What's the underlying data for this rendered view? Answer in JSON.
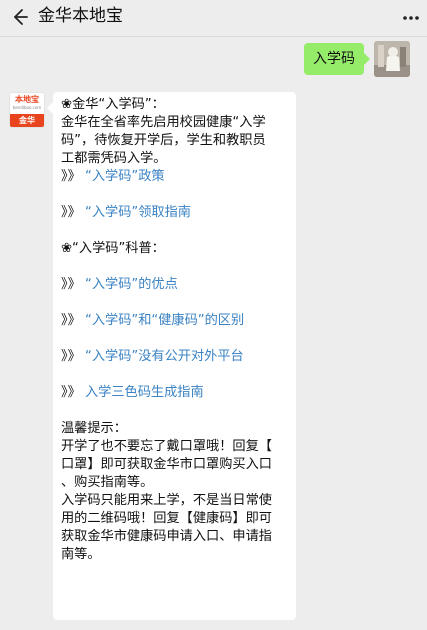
{
  "header": {
    "title": "金华本地宝",
    "back_icon": "chevron-left-icon",
    "more_icon": "more-dots-icon"
  },
  "outgoing": {
    "text": "入学码"
  },
  "bot_avatar": {
    "logo_text": "本地宝",
    "logo_sub": "bendibao.com",
    "city": "金华"
  },
  "message": {
    "line1": "❀金华“入学码”：",
    "line2": "金华在全省率先启用校园健康“入学",
    "line3": "码”，待恢复开学后，学生和教职员",
    "line4": "工都需凭码入学。",
    "links1": [
      {
        "prefix": "》》",
        "text": "“入学码”政策"
      },
      {
        "prefix": "》》",
        "text": "“入学码”领取指南"
      }
    ],
    "section2": "❀“入学码”科普：",
    "links2": [
      {
        "prefix": "》》",
        "text": "“入学码”的优点"
      },
      {
        "prefix": "》》",
        "text": "“入学码”和“健康码”的区别"
      },
      {
        "prefix": "》》",
        "text": "“入学码”没有公开对外平台"
      },
      {
        "prefix": "》》",
        "text": "入学三色码生成指南"
      }
    ],
    "tip_title": "温馨提示：",
    "tip1_l1": "开学了也不要忘了戴口罩哦！回复【",
    "tip1_l2": "口罩】即可获取金华市口罩购买入口",
    "tip1_l3": "、购买指南等。",
    "tip2_l1": "入学码只能用来上学，不是当日常使",
    "tip2_l2": "用的二维码哦！回复【健康码】即可",
    "tip2_l3": "获取金华市健康码申请入口、申请指",
    "tip2_l4": "南等。"
  },
  "colors": {
    "background": "#ededed",
    "outgoing_bubble": "#95ec69",
    "link": "#3b83c4",
    "logo": "#e8451e"
  }
}
